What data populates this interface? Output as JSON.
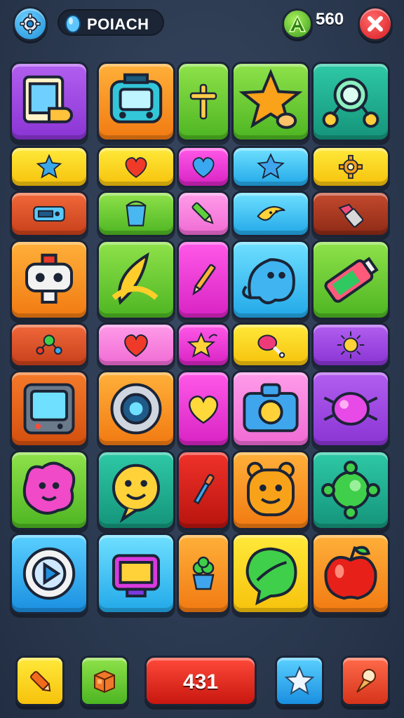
{
  "header": {
    "player_name": "POIACH",
    "score": "560",
    "icons": {
      "settings": "gear-icon",
      "gem": "gem-icon",
      "coin": "letter-a-coin-icon",
      "close": "close-icon"
    }
  },
  "board": {
    "rows": 8,
    "tiles": [
      {
        "icon": "tablet-hand-icon",
        "color": "purple"
      },
      {
        "icon": "robot-screen-icon",
        "color": "orange"
      },
      {
        "icon": "cross-stick-icon",
        "color": "green"
      },
      {
        "icon": "star-hand-icon",
        "color": "green"
      },
      {
        "icon": "magnifier-icon",
        "color": "teal"
      },
      {
        "icon": "puzzle-star-icon",
        "color": "yellow"
      },
      {
        "icon": "heart-icon",
        "color": "yellow"
      },
      {
        "icon": "blue-heart-icon",
        "color": "magenta"
      },
      {
        "icon": "star-icon",
        "color": "sky"
      },
      {
        "icon": "gear-icon",
        "color": "yellow"
      },
      {
        "icon": "gamepad-icon",
        "color": "brick"
      },
      {
        "icon": "bucket-icon",
        "color": "green"
      },
      {
        "icon": "crayon-icon",
        "color": "pink"
      },
      {
        "icon": "banana-icon",
        "color": "sky"
      },
      {
        "icon": "lipstick-icon",
        "color": "maroon"
      },
      {
        "icon": "robot-face-icon",
        "color": "orange"
      },
      {
        "icon": "banana-peel-icon",
        "color": "green"
      },
      {
        "icon": "pencil-icon",
        "color": "magenta"
      },
      {
        "icon": "blue-ghost-icon",
        "color": "sky"
      },
      {
        "icon": "battery-icon",
        "color": "green"
      },
      {
        "icon": "molecule-icon",
        "color": "brick"
      },
      {
        "icon": "red-heart-icon",
        "color": "pink"
      },
      {
        "icon": "star-wand-icon",
        "color": "magenta"
      },
      {
        "icon": "meat-icon",
        "color": "yellow"
      },
      {
        "icon": "sun-icon",
        "color": "purple"
      },
      {
        "icon": "tv-icon",
        "color": "rust"
      },
      {
        "icon": "speaker-icon",
        "color": "orange"
      },
      {
        "icon": "yellow-heart-icon",
        "color": "magenta"
      },
      {
        "icon": "camera-icon",
        "color": "pink"
      },
      {
        "icon": "beetle-icon",
        "color": "purple"
      },
      {
        "icon": "blob-monster-icon",
        "color": "green"
      },
      {
        "icon": "smiley-icon",
        "color": "teal"
      },
      {
        "icon": "dropper-icon",
        "color": "deepred"
      },
      {
        "icon": "teddy-icon",
        "color": "orange"
      },
      {
        "icon": "green-gear-icon",
        "color": "teal"
      },
      {
        "icon": "play-dial-icon",
        "color": "blue"
      },
      {
        "icon": "photo-kit-icon",
        "color": "sky"
      },
      {
        "icon": "plant-pot-icon",
        "color": "orange"
      },
      {
        "icon": "leaf-bubble-icon",
        "color": "yellow"
      },
      {
        "icon": "apple-icon",
        "color": "orange"
      }
    ]
  },
  "footer": {
    "moves": "431",
    "buttons": [
      {
        "icon": "crayon-icon",
        "color": "yellow"
      },
      {
        "icon": "cube-icon",
        "color": "green"
      },
      {
        "icon": "star-icon",
        "color": "blue"
      },
      {
        "icon": "ice-cream-icon",
        "color": "red"
      }
    ]
  }
}
